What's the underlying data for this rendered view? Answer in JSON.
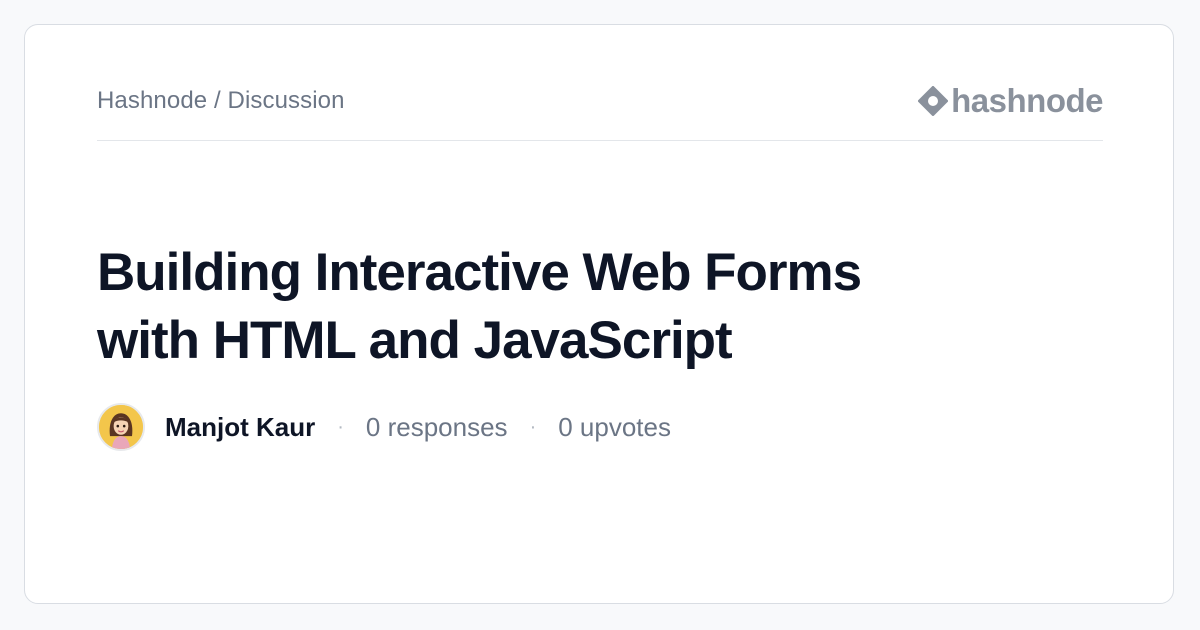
{
  "header": {
    "breadcrumb": "Hashnode / Discussion",
    "brand_name": "hashnode",
    "brand_icon": "hashnode-logo-icon"
  },
  "post": {
    "title_line1": "Building Interactive Web Forms",
    "title_line2": "with HTML and JavaScript"
  },
  "meta": {
    "author": "Manjot Kaur",
    "separator": "·",
    "responses": "0 responses",
    "upvotes": "0 upvotes",
    "avatar_icon": "user-avatar"
  },
  "colors": {
    "background": "#f8f9fb",
    "card": "#ffffff",
    "title": "#0e1526",
    "muted": "#6b7585",
    "brand": "#8a919c",
    "avatar_bg": "#f3c64b"
  }
}
